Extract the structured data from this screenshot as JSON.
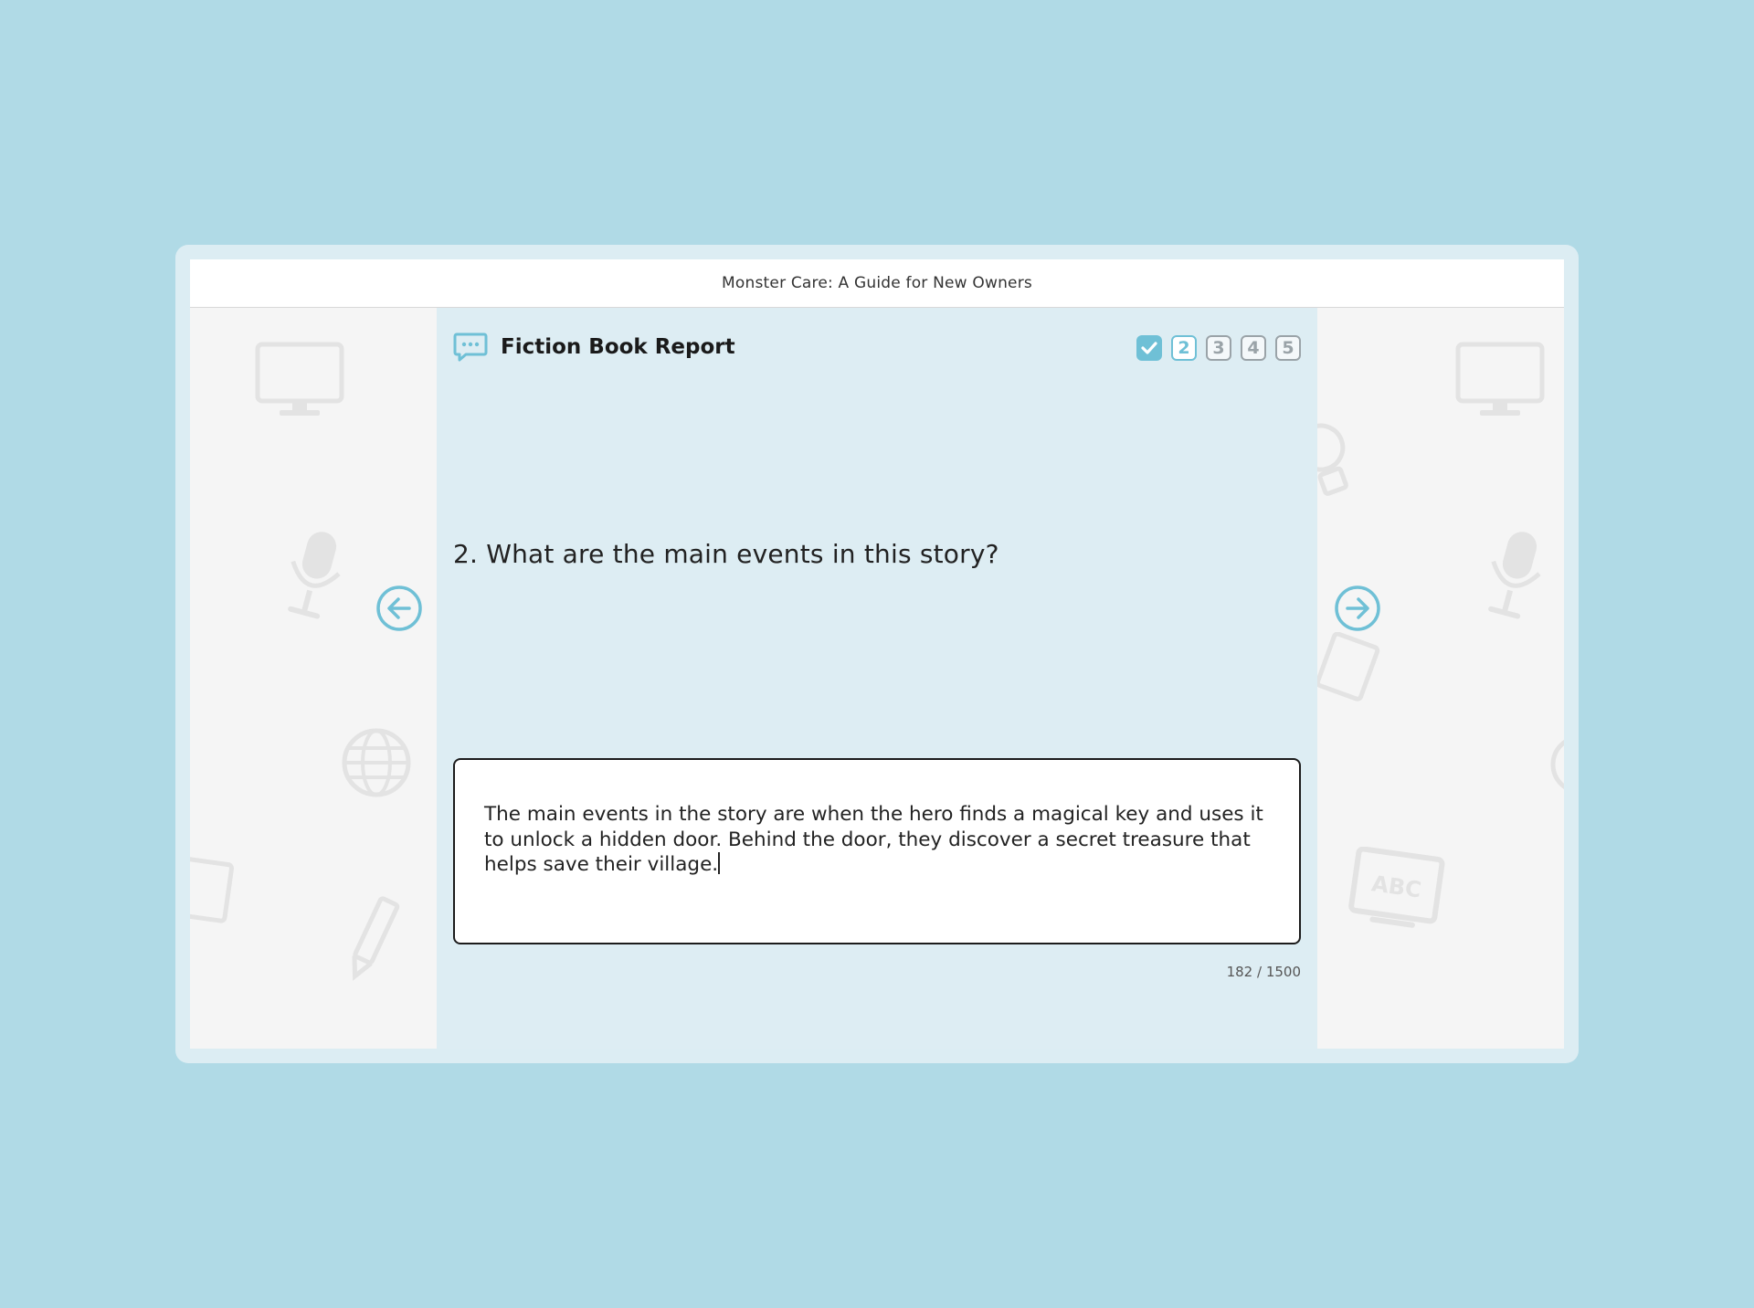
{
  "window": {
    "title": "Monster Care: A Guide for New Owners"
  },
  "activity": {
    "icon": "chat-bubble-icon",
    "title": "Fiction Book Report"
  },
  "steps": [
    {
      "label": "",
      "state": "done",
      "icon": "check-icon"
    },
    {
      "label": "2",
      "state": "current"
    },
    {
      "label": "3",
      "state": "upcoming"
    },
    {
      "label": "4",
      "state": "upcoming"
    },
    {
      "label": "5",
      "state": "upcoming"
    }
  ],
  "question": {
    "text": "2. What are the main events in this story?"
  },
  "answer": {
    "value": "The main events in the story are when the hero finds a magical key and uses it to unlock a hidden door. Behind the door, they discover a secret treasure that helps save their village.",
    "counter": "182 / 1500"
  },
  "navigation": {
    "prev_icon": "arrow-left-circle-icon",
    "next_icon": "arrow-right-circle-icon"
  },
  "colors": {
    "page_background": "#b0dae6",
    "accent": "#6fc0d6",
    "content_background": "#ddedf3"
  }
}
